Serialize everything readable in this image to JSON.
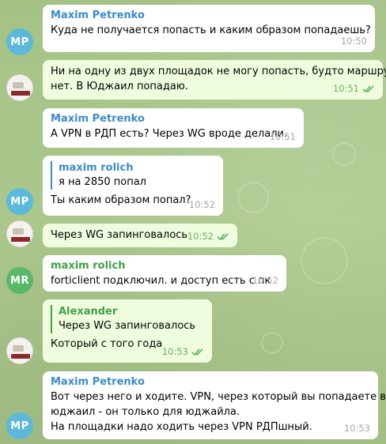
{
  "theme": {
    "incoming_bg": "#ffffff",
    "outgoing_bg": "#effdde",
    "sender_blue": "#3a8bc9",
    "sender_green": "#43a047",
    "avatar_mp": "#5bb9dc",
    "avatar_mr": "#58b768"
  },
  "avatars": {
    "mp": "MP",
    "mr": "MR"
  },
  "messages": [
    {
      "sender": "Maxim Petrenko",
      "lines": [
        "Куда не получается попасть и каким образом попадаешь?"
      ],
      "time": "10:50"
    },
    {
      "lines": [
        "Ни на одну из двух площадок не могу попасть, будто маршрута",
        "нет. В Юджаил попадаю."
      ],
      "time": "10:51",
      "status": "read"
    },
    {
      "sender": "Maxim Petrenko",
      "lines": [
        "А VPN в РДП есть? Через WG вроде делали."
      ],
      "time": "10:51"
    },
    {
      "quote_sender": "maxim rolich",
      "quote_text": "я на 2850 попал",
      "lines": [
        "Ты каким образом попал?"
      ],
      "time": "10:52"
    },
    {
      "lines": [
        "Через WG запинговалось"
      ],
      "time": "10:52",
      "status": "read"
    },
    {
      "sender": "maxim rolich",
      "lines": [
        "forticlient подключил. и доступ есть с пк"
      ],
      "time": "10:52"
    },
    {
      "quote_sender": "Alexander",
      "quote_text": "Через WG запинговалось",
      "lines": [
        "Который с того года"
      ],
      "time": "10:53",
      "status": "read"
    },
    {
      "sender": "Maxim Petrenko",
      "lines": [
        "Вот через него и ходите. VPN, через который вы попадаете в",
        "юджаил - он только для юджайла.",
        "На площадки надо ходить через VPN РДПшный."
      ],
      "time": "10:53"
    }
  ]
}
